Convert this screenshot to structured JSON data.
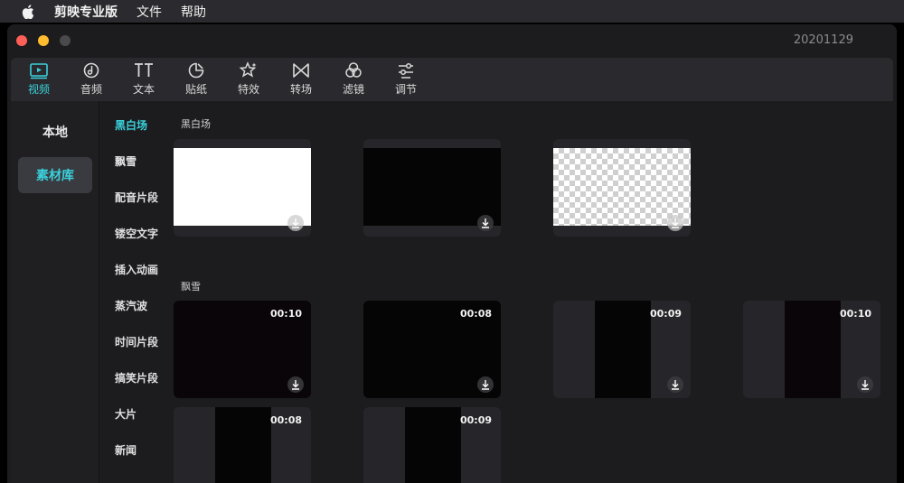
{
  "menubar": {
    "app_name": "剪映专业版",
    "items": [
      "文件",
      "帮助"
    ]
  },
  "window": {
    "title": "20201129"
  },
  "toolbar": {
    "tabs": [
      {
        "label": "视频",
        "icon": "video-icon",
        "active": true
      },
      {
        "label": "音频",
        "icon": "audio-icon",
        "active": false
      },
      {
        "label": "文本",
        "icon": "text-icon",
        "active": false
      },
      {
        "label": "贴纸",
        "icon": "sticker-icon",
        "active": false
      },
      {
        "label": "特效",
        "icon": "effects-icon",
        "active": false
      },
      {
        "label": "转场",
        "icon": "transition-icon",
        "active": false
      },
      {
        "label": "滤镜",
        "icon": "filter-icon",
        "active": false
      },
      {
        "label": "调节",
        "icon": "adjust-icon",
        "active": false
      }
    ]
  },
  "leftnav": {
    "items": [
      {
        "label": "本地",
        "active": false
      },
      {
        "label": "素材库",
        "active": true
      }
    ]
  },
  "categories": [
    {
      "label": "黑白场",
      "active": true
    },
    {
      "label": "飘雪",
      "active": false
    },
    {
      "label": "配音片段",
      "active": false
    },
    {
      "label": "镂空文字",
      "active": false
    },
    {
      "label": "插入动画",
      "active": false
    },
    {
      "label": "蒸汽波",
      "active": false
    },
    {
      "label": "时间片段",
      "active": false
    },
    {
      "label": "搞笑片段",
      "active": false
    },
    {
      "label": "大片",
      "active": false
    },
    {
      "label": "新闻",
      "active": false
    }
  ],
  "sections": [
    {
      "title": "黑白场",
      "items": [
        {
          "kind": "white"
        },
        {
          "kind": "black"
        },
        {
          "kind": "transparent"
        }
      ]
    },
    {
      "title": "飘雪",
      "items": [
        {
          "duration": "00:10"
        },
        {
          "duration": "00:08"
        },
        {
          "duration": "00:09"
        },
        {
          "duration": "00:10"
        },
        {
          "duration": "00:08"
        },
        {
          "duration": "00:09"
        }
      ]
    }
  ],
  "colors": {
    "accent": "#3ad2dc",
    "window_bg": "#1c1c1f",
    "toolbar_bg": "#2a2a2e"
  }
}
